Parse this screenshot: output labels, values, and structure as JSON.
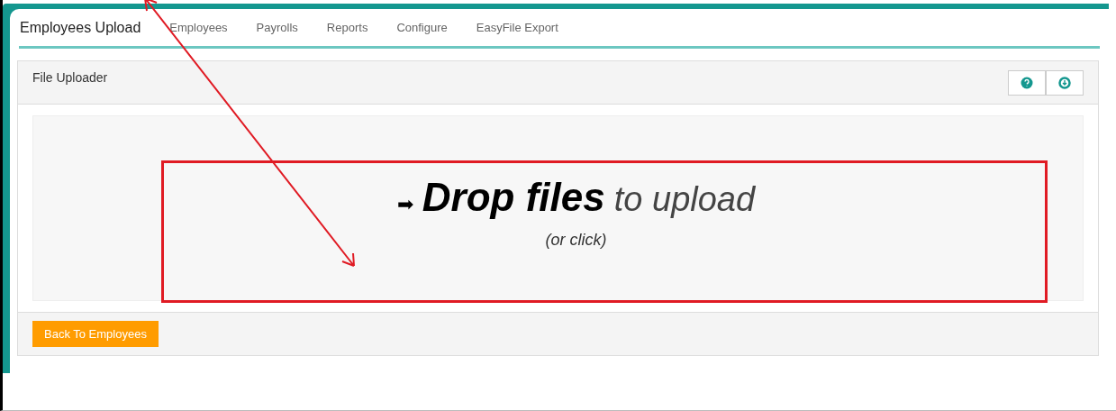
{
  "tabs": [
    {
      "label": "Employees Upload",
      "selected": true
    },
    {
      "label": "Employees",
      "selected": false
    },
    {
      "label": "Payrolls",
      "selected": false
    },
    {
      "label": "Reports",
      "selected": false
    },
    {
      "label": "Configure",
      "selected": false
    },
    {
      "label": "EasyFile Export",
      "selected": false
    }
  ],
  "panel": {
    "title": "File Uploader",
    "dropzone": {
      "arrow": "➡",
      "main": "Drop files",
      "secondary": "to upload",
      "hint": "(or click)"
    },
    "back_button": "Back To Employees"
  }
}
